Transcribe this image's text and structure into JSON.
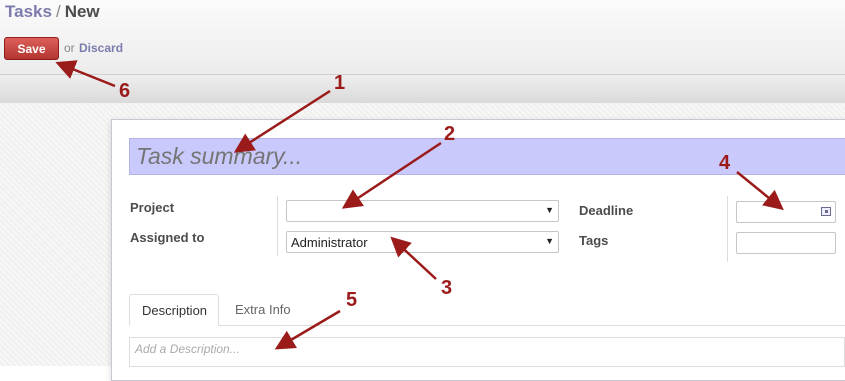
{
  "breadcrumb": {
    "parent": "Tasks",
    "separator": "/",
    "current": "New"
  },
  "toolbar": {
    "save_label": "Save",
    "or_text": "or",
    "discard_label": "Discard"
  },
  "form": {
    "summary_placeholder": "Task summary...",
    "project": {
      "label": "Project",
      "value": ""
    },
    "assigned_to": {
      "label": "Assigned to",
      "value": "Administrator"
    },
    "deadline": {
      "label": "Deadline",
      "value": ""
    },
    "tags": {
      "label": "Tags",
      "value": ""
    }
  },
  "tabs": [
    {
      "label": "Description",
      "active": true
    },
    {
      "label": "Extra Info",
      "active": false
    }
  ],
  "description_placeholder": "Add a Description...",
  "annotations": [
    "1",
    "2",
    "3",
    "4",
    "5",
    "6"
  ],
  "colors": {
    "accent": "#7c7bad",
    "save": "#c0392b",
    "summary_bg": "#c9c9fb",
    "annotation": "#9b1b1b"
  },
  "icons": {
    "dropdown": "caret-down-icon",
    "calendar": "calendar-icon"
  }
}
